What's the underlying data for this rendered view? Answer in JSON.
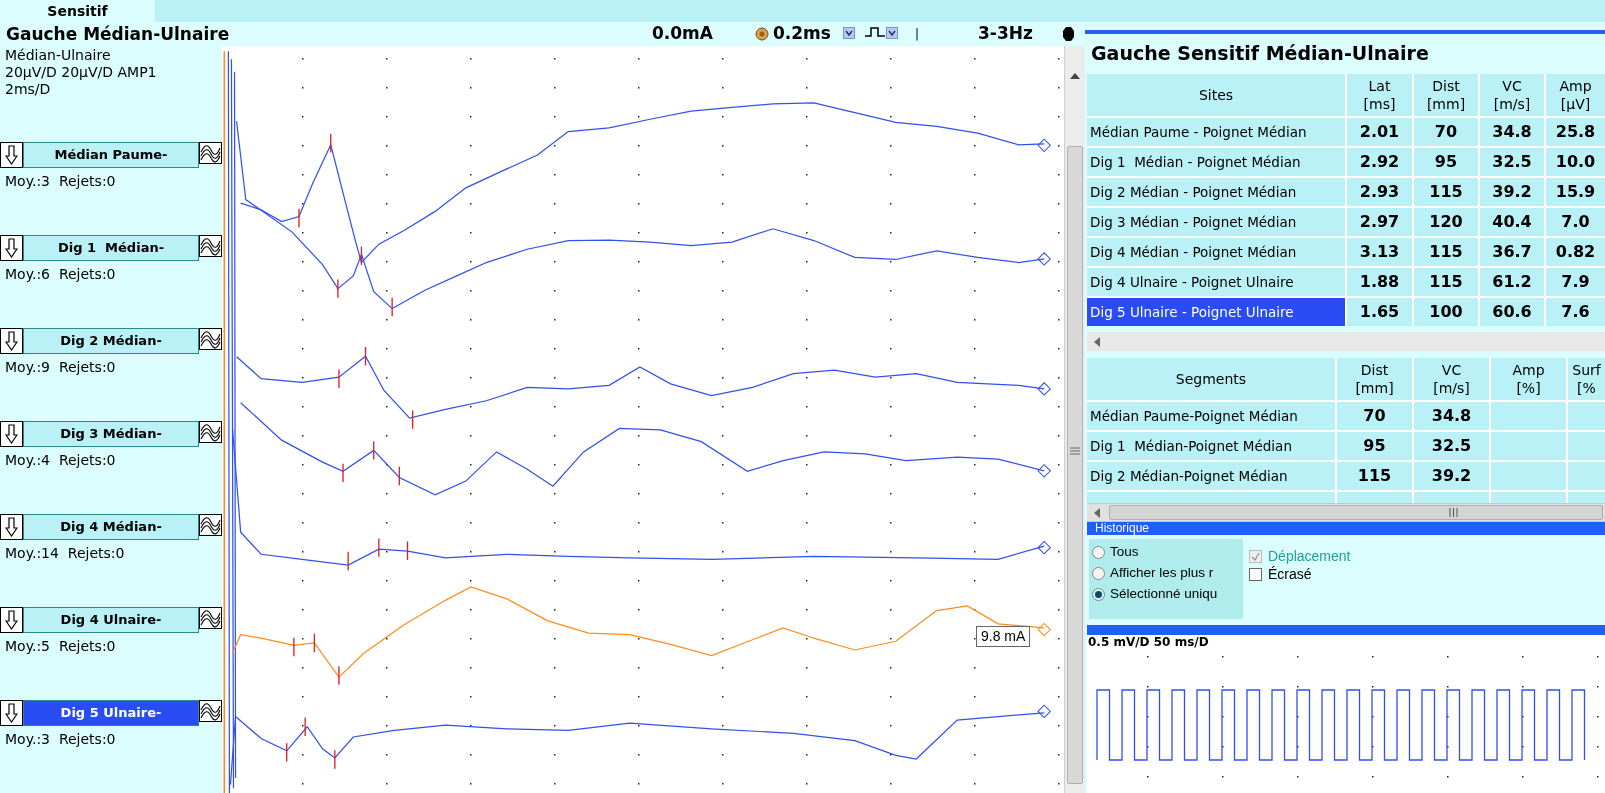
{
  "tab": {
    "label": "Sensitif",
    "selected": true
  },
  "header": {
    "title": "Gauche Médian-Ulnaire",
    "intensity": "0.0mA",
    "duration": "0.2ms",
    "separator": "|",
    "frequency": "3-3Hz"
  },
  "info_lines": [
    "Médian-Ulnaire",
    "20µV/D 20µV/D AMP1",
    "2ms/D"
  ],
  "channels": [
    {
      "label": "Médian Paume-",
      "stats": "Moy.:3  Rejets:0",
      "selected": false,
      "color": "#3050f0"
    },
    {
      "label": "Dig 1  Médian-",
      "stats": "Moy.:6  Rejets:0",
      "selected": false,
      "color": "#3050f0"
    },
    {
      "label": "Dig 2 Médian-",
      "stats": "Moy.:9  Rejets:0",
      "selected": false,
      "color": "#3050f0"
    },
    {
      "label": "Dig 3 Médian-",
      "stats": "Moy.:4  Rejets:0",
      "selected": false,
      "color": "#3050f0"
    },
    {
      "label": "Dig 4 Médian-",
      "stats": "Moy.:14  Rejets:0",
      "selected": false,
      "color": "#3050f0"
    },
    {
      "label": "Dig 4 Ulnaire-",
      "stats": "Moy.:5  Rejets:0",
      "selected": false,
      "color": "#ff8c1a"
    },
    {
      "label": "Dig 5 Ulnaire-",
      "stats": "Moy.:3  Rejets:0",
      "selected": true,
      "color": "#3050f0"
    }
  ],
  "trace_callout": "9.8 mA",
  "results": {
    "title": "Gauche Sensitif Médian-Ulnaire",
    "columns": [
      {
        "name": "Sites"
      },
      {
        "name": "Lat",
        "unit": "[ms]"
      },
      {
        "name": "Dist",
        "unit": "[mm]"
      },
      {
        "name": "VC",
        "unit": "[m/s]"
      },
      {
        "name": "Amp",
        "unit": "[µV]"
      }
    ],
    "rows": [
      {
        "site": "Médian Paume - Poignet Médian",
        "values": [
          "2.01",
          "70",
          "34.8",
          "25.8"
        ],
        "selected": false
      },
      {
        "site": "Dig 1  Médian - Poignet Médian",
        "values": [
          "2.92",
          "95",
          "32.5",
          "10.0"
        ],
        "selected": false
      },
      {
        "site": "Dig 2 Médian - Poignet Médian",
        "values": [
          "2.93",
          "115",
          "39.2",
          "15.9"
        ],
        "selected": false
      },
      {
        "site": "Dig 3 Médian - Poignet Médian",
        "values": [
          "2.97",
          "120",
          "40.4",
          "7.0"
        ],
        "selected": false
      },
      {
        "site": "Dig 4 Médian - Poignet Médian",
        "values": [
          "3.13",
          "115",
          "36.7",
          "0.82"
        ],
        "selected": false
      },
      {
        "site": "Dig 4 Ulnaire - Poignet Ulnaire",
        "values": [
          "1.88",
          "115",
          "61.2",
          "7.9"
        ],
        "selected": false
      },
      {
        "site": "Dig 5 Ulnaire - Poignet Ulnaire",
        "values": [
          "1.65",
          "100",
          "60.6",
          "7.6"
        ],
        "selected": true
      }
    ]
  },
  "segments": {
    "columns": [
      {
        "name": "Segments"
      },
      {
        "name": "Dist",
        "unit": "[mm]"
      },
      {
        "name": "VC",
        "unit": "[m/s]"
      },
      {
        "name": "Amp",
        "unit": "[%]"
      },
      {
        "name": "Surf",
        "unit": "[%"
      }
    ],
    "rows": [
      {
        "name": "Médian Paume-Poignet Médian",
        "values": [
          "70",
          "34.8"
        ]
      },
      {
        "name": "Dig 1  Médian-Poignet Médian",
        "values": [
          "95",
          "32.5"
        ]
      },
      {
        "name": "Dig 2 Médian-Poignet Médian",
        "values": [
          "115",
          "39.2"
        ]
      }
    ]
  },
  "history": {
    "title": "Historique",
    "options": [
      {
        "label": "Tous",
        "selected": false
      },
      {
        "label": "Afficher les plus r",
        "selected": false
      },
      {
        "label": "Sélectionné uniqu",
        "selected": true
      }
    ],
    "checks": [
      {
        "label": "Déplacement",
        "checked": true,
        "disabled": true
      },
      {
        "label": "Écrasé",
        "checked": false,
        "disabled": false
      }
    ]
  },
  "scope": {
    "scale": "0.5 mV/D 50 ms/D"
  }
}
